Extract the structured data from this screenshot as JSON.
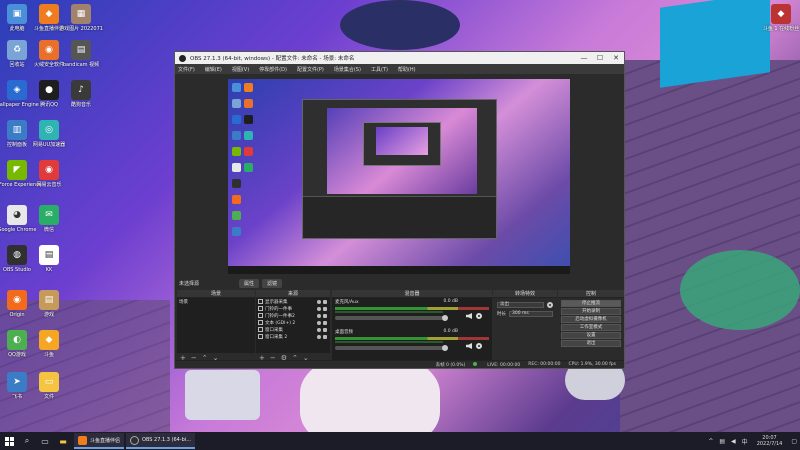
{
  "desktop_icons": [
    {
      "label": "此电脑",
      "color": "#4a90d9",
      "glyph": "▣"
    },
    {
      "label": "斗鱼直播伴侣",
      "color": "#f07c20",
      "glyph": "◆"
    },
    {
      "label": "游戏图片 2022071",
      "color": "#a0826d",
      "glyph": "▦"
    },
    {
      "label": "回收站",
      "color": "#7aa4d6",
      "glyph": "♻"
    },
    {
      "label": "火绒安全软件",
      "color": "#e8702a",
      "glyph": "◉"
    },
    {
      "label": "bandicam 视频",
      "color": "#555555",
      "glyph": "▤"
    },
    {
      "label": "Wallpaper Engine",
      "color": "#2a6bd1",
      "glyph": "◈"
    },
    {
      "label": "腾讯QQ",
      "color": "#1e1e1e",
      "glyph": "●"
    },
    {
      "label": "酷狗音乐",
      "color": "#3a3a3a",
      "glyph": "♪"
    },
    {
      "label": "控制面板",
      "color": "#3a7cc6",
      "glyph": "▥"
    },
    {
      "label": "网易UU加速器",
      "color": "#2fb3b3",
      "glyph": "◎"
    },
    {
      "label": "GeForce Experience",
      "color": "#76b900",
      "glyph": "◤"
    },
    {
      "label": "网易云音乐",
      "color": "#e03a3a",
      "glyph": "◉"
    },
    {
      "label": "Google Chrome",
      "color": "#e8e8e8",
      "glyph": "◕"
    },
    {
      "label": "微信",
      "color": "#2aae67",
      "glyph": "✉"
    },
    {
      "label": "OBS Studio",
      "color": "#303030",
      "glyph": "◍"
    },
    {
      "label": "KK",
      "color": "#ffffff",
      "glyph": "▤"
    },
    {
      "label": "Origin",
      "color": "#f26b1d",
      "glyph": "◉"
    },
    {
      "label": "游戏",
      "color": "#c69a5a",
      "glyph": "▤"
    },
    {
      "label": "QQ游戏",
      "color": "#4caf50",
      "glyph": "◐"
    },
    {
      "label": "斗鱼",
      "color": "#f5a623",
      "glyph": "◆"
    },
    {
      "label": "飞书",
      "color": "#3a7cc6",
      "glyph": "➤"
    },
    {
      "label": "文件",
      "color": "#f5c542",
      "glyph": "▭"
    }
  ],
  "corner_icon": {
    "label": "斗鱼 1 在线粉丝"
  },
  "obs": {
    "title": "OBS 27.1.3 (64-bit, windows) - 配置文件: 未命名 - 场景: 未命名",
    "menu": [
      "文件(F)",
      "编辑(E)",
      "视图(V)",
      "停靠部件(D)",
      "配置文件(P)",
      "场景集合(S)",
      "工具(T)",
      "帮助(H)"
    ],
    "source_bar": {
      "label": "未选择源",
      "props": "属性",
      "filters": "滤镜"
    },
    "docks": {
      "scenes": {
        "title": "场景",
        "items": [
          "场景"
        ]
      },
      "sources": {
        "title": "来源",
        "items": [
          "显示器采集",
          "门铃的一件事",
          "门铃的一件事2",
          "文本 (GDI+) 2",
          "窗口采集",
          "窗口采集 2"
        ]
      },
      "mixer": {
        "title": "混音器",
        "channels": [
          {
            "name": "麦克风/Aux",
            "db": "0.0 dB"
          },
          {
            "name": "桌面音频",
            "db": "0.0 dB"
          }
        ]
      },
      "transitions": {
        "title": "转场特效",
        "type": "淡出",
        "duration_label": "时长",
        "duration": "300 ms"
      },
      "controls": {
        "title": "控制",
        "buttons": [
          "停止推流",
          "开始录制",
          "启动虚拟摄像机",
          "工作室模式",
          "设置",
          "退出"
        ]
      }
    },
    "status": {
      "dropped": "丢帧 0 (0.0%)",
      "live": "LIVE: 00:00:00",
      "rec": "REC: 00:00:00",
      "cpu": "CPU: 1.9%, 30.00 fps"
    }
  },
  "taskbar": {
    "tasks": [
      {
        "label": "斗鱼直播伴侣",
        "color": "#f07c20"
      },
      {
        "label": "OBS 27.1.3 (64-bi...",
        "color": "#303030"
      }
    ],
    "tray": {
      "caret": "^",
      "lang": "中",
      "time": "20:07",
      "date": "2022/7/14"
    }
  }
}
